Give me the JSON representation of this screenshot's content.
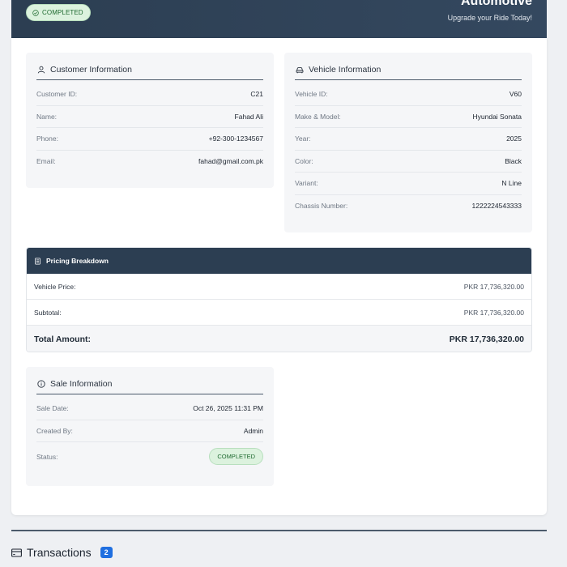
{
  "header": {
    "status_badge": "COMPLETED",
    "brand_name": "Automotive",
    "brand_tagline": "Upgrade your Ride Today!"
  },
  "customer": {
    "title": "Customer Information",
    "rows": [
      {
        "label": "Customer ID:",
        "value": "C21"
      },
      {
        "label": "Name:",
        "value": "Fahad Ali"
      },
      {
        "label": "Phone:",
        "value": "+92-300-1234567"
      },
      {
        "label": "Email:",
        "value": "fahad@gmail.com.pk"
      }
    ]
  },
  "vehicle": {
    "title": "Vehicle Information",
    "rows": [
      {
        "label": "Vehicle ID:",
        "value": "V60"
      },
      {
        "label": "Make & Model:",
        "value": "Hyundai Sonata"
      },
      {
        "label": "Year:",
        "value": "2025"
      },
      {
        "label": "Color:",
        "value": "Black"
      },
      {
        "label": "Variant:",
        "value": "N Line"
      },
      {
        "label": "Chassis Number:",
        "value": "1222224543333"
      }
    ]
  },
  "pricing": {
    "title": "Pricing Breakdown",
    "vehicle_price_label": "Vehicle Price:",
    "vehicle_price_value": "PKR 17,736,320.00",
    "subtotal_label": "Subtotal:",
    "subtotal_value": "PKR 17,736,320.00",
    "total_label": "Total Amount:",
    "total_value": "PKR 17,736,320.00"
  },
  "sale": {
    "title": "Sale Information",
    "sale_date_label": "Sale Date:",
    "sale_date_value": "Oct 26, 2025 11:31 PM",
    "created_by_label": "Created By:",
    "created_by_value": "Admin",
    "status_label": "Status:",
    "status_value": "COMPLETED"
  },
  "transactions": {
    "title": "Transactions",
    "count": "2"
  },
  "colors": {
    "header_bg": "#2c3e52",
    "success_bg": "#dcf2de",
    "success_text": "#1f6a30",
    "count_badge": "#1f6fe0"
  }
}
